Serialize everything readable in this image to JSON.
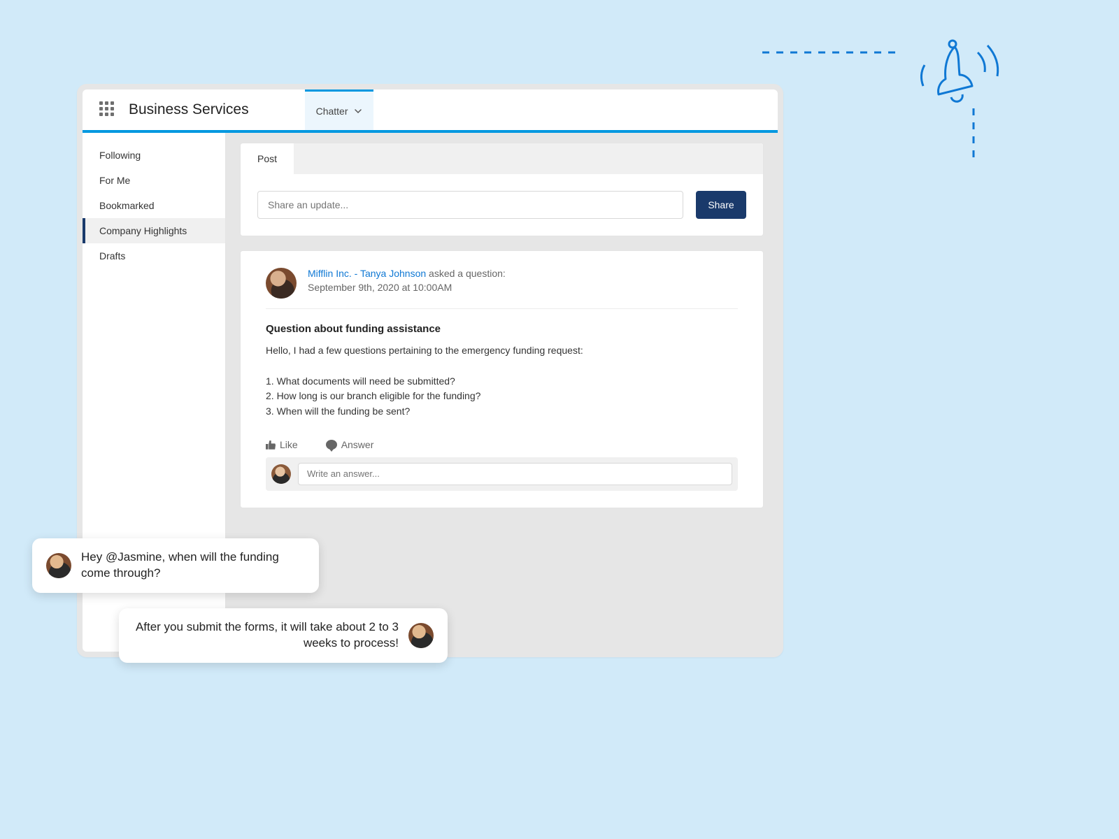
{
  "header": {
    "title": "Business Services",
    "tab_label": "Chatter"
  },
  "sidebar": {
    "items": [
      {
        "label": "Following"
      },
      {
        "label": "For Me"
      },
      {
        "label": "Bookmarked"
      },
      {
        "label": "Company Highlights"
      },
      {
        "label": "Drafts"
      }
    ]
  },
  "composer": {
    "tab_label": "Post",
    "placeholder": "Share an update...",
    "share_label": "Share"
  },
  "post": {
    "company": "Mifflin Inc.",
    "author": "Tanya Johnson",
    "suffix": "asked a question:",
    "timestamp": "September 9th, 2020 at 10:00AM",
    "title": "Question about funding assistance",
    "intro": "Hello, I had a few questions pertaining to the emergency funding request:",
    "q1": "1. What documents will need be submitted?",
    "q2": "2. How long is our branch eligible for the funding?",
    "q3": "3. When will the funding be sent?",
    "like_label": "Like",
    "answer_label": "Answer",
    "answer_placeholder": "Write an answer..."
  },
  "chat": {
    "msg1": "Hey @Jasmine, when will the funding come through?",
    "msg2": "After you submit the forms, it will take about 2 to 3 weeks to process!"
  },
  "icons": {
    "app_launcher": "app-launcher-icon",
    "chevron_down": "chevron-down-icon",
    "thumb": "thumb-up-icon",
    "speech": "speech-bubble-icon",
    "bell": "bell-ringing-icon"
  }
}
